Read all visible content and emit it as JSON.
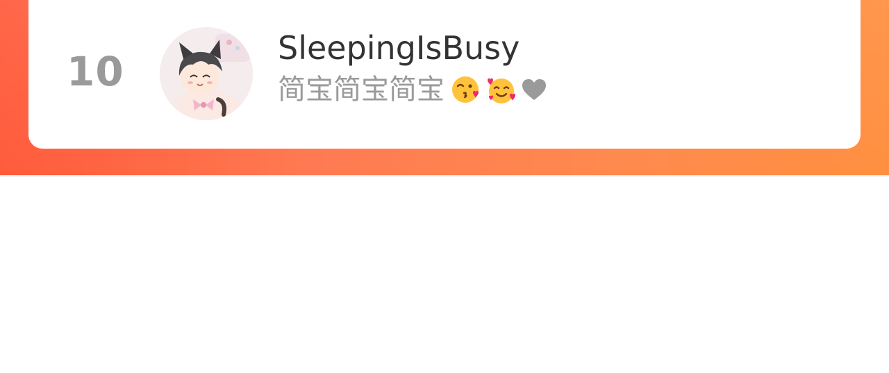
{
  "entry": {
    "rank": "10",
    "username": "SleepingIsBusy",
    "bio_text": "简宝简宝简宝",
    "bio_icons": [
      "kissing-face-icon",
      "smiling-face-with-hearts-icon",
      "grey-heart-icon"
    ],
    "avatar": "anime-cat-boy-avatar"
  },
  "colors": {
    "banner_start": "#ff5a3a",
    "banner_end": "#ff8f3f",
    "rank": "#9a9a9a",
    "username": "#333333",
    "bio": "#9a9a9a"
  }
}
